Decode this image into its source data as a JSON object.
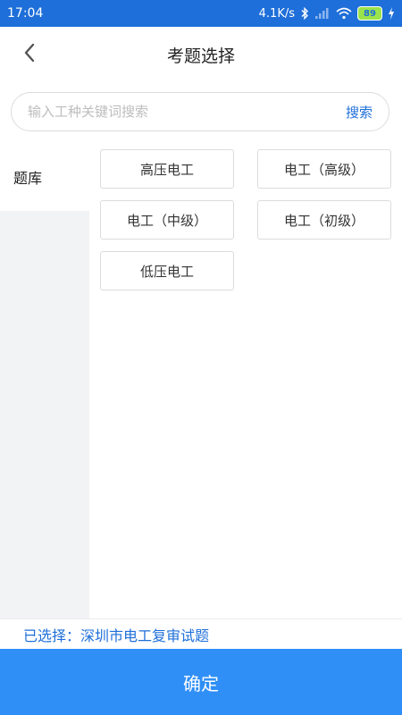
{
  "status_bar": {
    "time": "17:04",
    "network_speed": "4.1K/s",
    "battery": "89",
    "icons": [
      "bluetooth-icon",
      "signal-icon",
      "wifi-icon",
      "battery-icon",
      "charging-icon"
    ]
  },
  "header": {
    "title": "考题选择",
    "back_icon": "chevron-left-icon"
  },
  "search": {
    "placeholder": "输入工种关键词搜索",
    "value": "",
    "button_label": "搜索"
  },
  "sidebar": {
    "items": [
      {
        "label": "题库",
        "selected": true
      }
    ]
  },
  "options": [
    {
      "label": "高压电工"
    },
    {
      "label": "电工（高级）"
    },
    {
      "label": "电工（中级）"
    },
    {
      "label": "电工（初级）"
    },
    {
      "label": "低压电工"
    }
  ],
  "selected": {
    "text": "已选择：深圳市电工复审试题"
  },
  "confirm": {
    "label": "确定"
  },
  "colors": {
    "status_bar": "#1e6fd9",
    "accent": "#1e6fd9",
    "confirm_button": "#2f8ff7",
    "sidebar_bg": "#f2f3f5"
  }
}
